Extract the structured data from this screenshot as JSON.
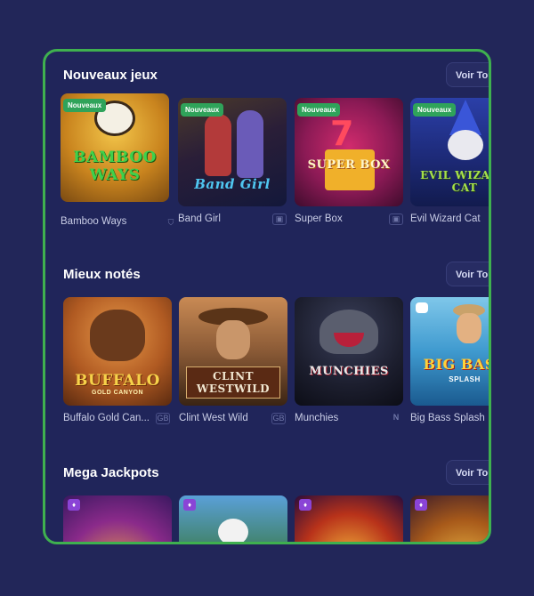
{
  "sections": [
    {
      "title": "Nouveaux jeux",
      "see_all": "Voir Tout",
      "games": [
        {
          "name": "Bamboo Ways",
          "badge": "Nouveaux",
          "logo": "BAMBOO WAYS",
          "provider_icon": "shield-icon"
        },
        {
          "name": "Band Girl",
          "badge": "Nouveaux",
          "logo": "Band Girl",
          "provider_icon": "chip-icon"
        },
        {
          "name": "Super Box",
          "badge": "Nouveaux",
          "logo": "SUPER BOX",
          "provider_icon": "chip-icon"
        },
        {
          "name": "Evil Wizard Cat",
          "badge": "Nouveaux",
          "logo": "EVIL WIZARD CAT",
          "provider_icon": ""
        }
      ]
    },
    {
      "title": "Mieux notés",
      "see_all": "Voir Tout",
      "games": [
        {
          "name": "Buffalo Gold Can...",
          "logo": "BUFFALO",
          "logo_sub": "GOLD CANYON",
          "provider_icon": "gb-icon",
          "provider_text": "GB"
        },
        {
          "name": "Clint West Wild",
          "logo": "CLINT WESTWILD",
          "provider_icon": "gb-icon",
          "provider_text": "GB"
        },
        {
          "name": "Munchies",
          "logo": "MUNCHIES",
          "provider_icon": "n-icon",
          "provider_text": "N"
        },
        {
          "name": "Big Bass Splash",
          "logo": "BIG BASS",
          "logo_sub": "SPLASH",
          "provider_icon": ""
        }
      ]
    },
    {
      "title": "Mega Jackpots",
      "see_all": "Voir Tout",
      "games": [
        {
          "name": "",
          "jackpot_badge": "diamond-icon"
        },
        {
          "name": "",
          "jackpot_badge": "diamond-icon"
        },
        {
          "name": "",
          "jackpot_badge": "diamond-icon"
        },
        {
          "name": "",
          "jackpot_badge": "diamond-icon"
        }
      ]
    }
  ],
  "colors": {
    "background": "#222659",
    "frame_border": "#3fb04f",
    "badge_new": "#2fa35a",
    "badge_jackpot": "#8a44d6"
  }
}
